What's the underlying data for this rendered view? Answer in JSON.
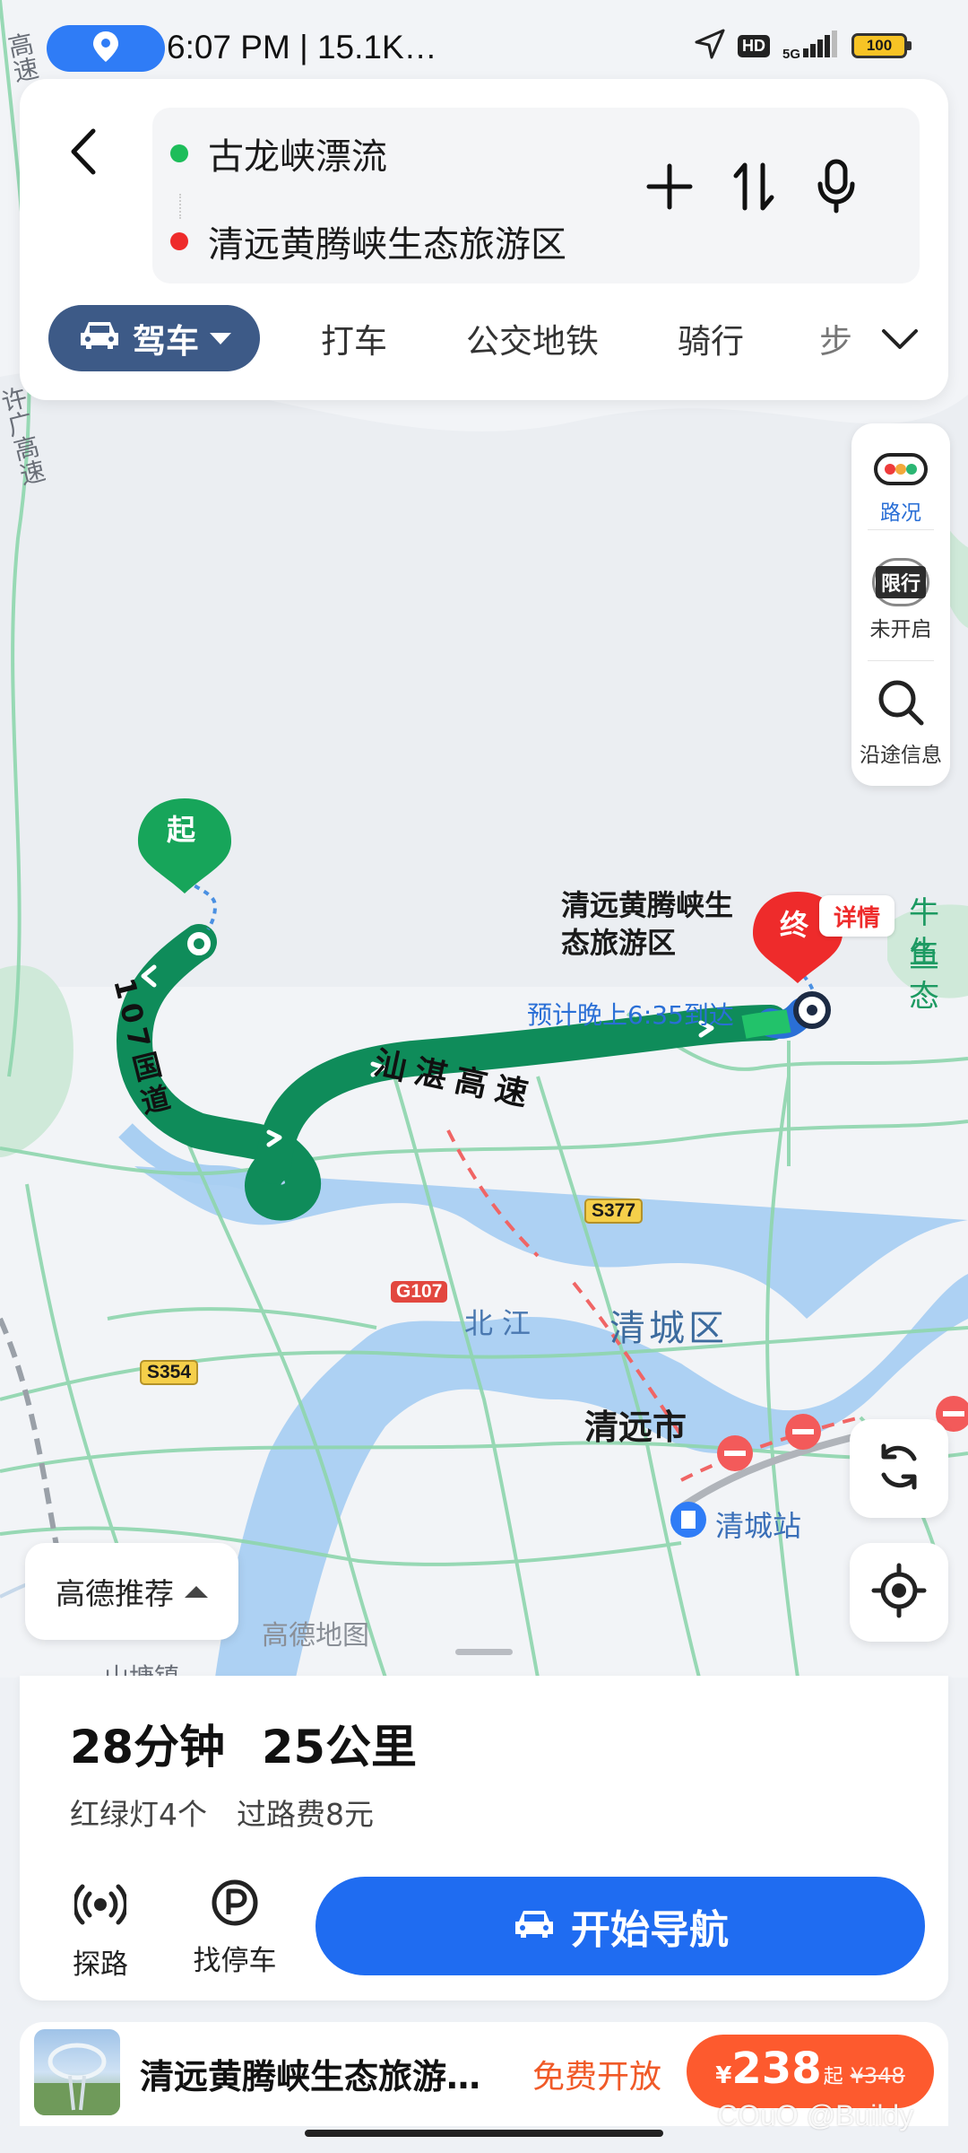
{
  "status_bar": {
    "time": "6:07 PM | 15.1K…",
    "hd": "HD",
    "network": "5G",
    "battery": "100"
  },
  "route": {
    "origin": "古龙峡漂流",
    "destination": "清远黄腾峡生态旅游区",
    "add_label": "+",
    "swap_icon": "swap-icon",
    "voice_icon": "microphone-icon"
  },
  "modes": {
    "active": "驾车",
    "items": [
      "打车",
      "公交地铁",
      "骑行",
      "步"
    ]
  },
  "tools": {
    "traffic": "路况",
    "restriction_badge": "限行",
    "restriction": "未开启",
    "along_route": "沿途信息"
  },
  "map": {
    "start_marker": "起",
    "end_marker": "终",
    "detail": "详情",
    "destination_label_line1": "清远黄腾峡生",
    "destination_label_line2": "态旅游区",
    "eta": "预计晚上6:35到达",
    "road_highway": "汕湛高速",
    "road_national": "107国道",
    "road_s377": "S377",
    "road_g107": "G107",
    "road_s354": "S354",
    "river": "北江",
    "district": "清城区",
    "city": "清远市",
    "station": "清城站",
    "poi_right_1": "牛鱼",
    "poi_right_2": "生态",
    "left_road": "许广高速",
    "top_left_road": "高速",
    "watermark": "高德地图",
    "bottom_partial": "山塘镇"
  },
  "recommend": "高德推荐",
  "summary": {
    "duration": "28分钟",
    "distance": "25公里",
    "lights": "红绿灯4个",
    "toll": "过路费8元"
  },
  "actions": {
    "explore": "探路",
    "parking": "找停车",
    "start_nav": "开始导航"
  },
  "poi": {
    "name": "清远黄腾峡生态旅游…",
    "open": "免费开放",
    "currency": "¥",
    "price": "238",
    "price_suffix": "起",
    "original_price": "¥348"
  },
  "overlay_watermark": "COuO @Buildy",
  "colors": {
    "route_green": "#0f8c5a",
    "accent_blue": "#1f6cf1",
    "mode_active": "#3d5a87",
    "price_orange": "#fd5a2e"
  }
}
